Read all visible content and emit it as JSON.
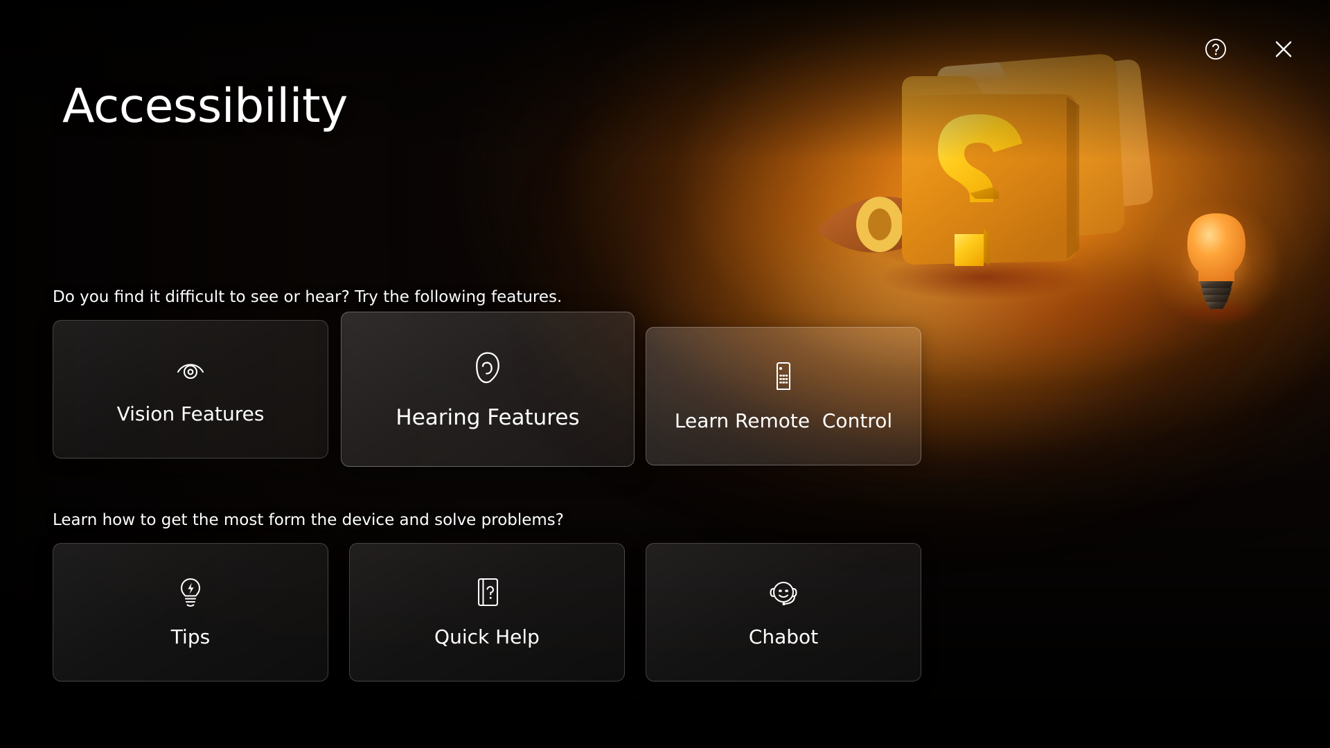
{
  "window": {
    "title": "Accessibility",
    "help_button": "?",
    "close_button": "✕",
    "help_icon": "question-circle-icon",
    "close_icon": "close-x-icon"
  },
  "hero": {
    "illustration": "3d-folder-question-mark-eye-lightbulb",
    "colors": {
      "folder_front": "#e8921b",
      "folder_mid": "#f0a12a",
      "folder_back": "#f6b755",
      "question_mark": "#ffc715",
      "question_mark_highlight": "#ffd94a",
      "eye": "#b35b1d",
      "eye_pupil": "#f2c04a",
      "bulb_glass": "#ff9a2e",
      "bulb_base": "#4a3a2a",
      "glow": "#ff9d28"
    }
  },
  "sections": [
    {
      "id": "vision",
      "label": "Do you find it difficult to see or hear? Try the following features.",
      "cards": [
        {
          "id": "vision-features",
          "label": "Vision Features",
          "icon": "eye-icon",
          "focused": false
        },
        {
          "id": "hearing-features",
          "label": "Hearing Features",
          "icon": "ear-icon",
          "focused": true
        },
        {
          "id": "learn-remote-control",
          "label": "Learn Remote  Control",
          "icon": "remote-control-icon",
          "focused": false
        }
      ]
    },
    {
      "id": "learn",
      "label": "Learn how to get the most form the device and solve problems?",
      "cards": [
        {
          "id": "tips",
          "label": "Tips",
          "icon": "lightbulb-bolt-icon",
          "focused": false
        },
        {
          "id": "quick-help",
          "label": "Quick Help",
          "icon": "manual-question-icon",
          "focused": false
        },
        {
          "id": "chabot",
          "label": "Chabot",
          "icon": "headset-smiley-icon",
          "focused": false
        }
      ]
    }
  ],
  "theme": {
    "background_dark": "#070403",
    "accent_orange": "#e8891a",
    "glow_orange": "#ffa023",
    "text_primary": "#ffffff",
    "card_border": "rgba(255,255,255,0.20)"
  }
}
